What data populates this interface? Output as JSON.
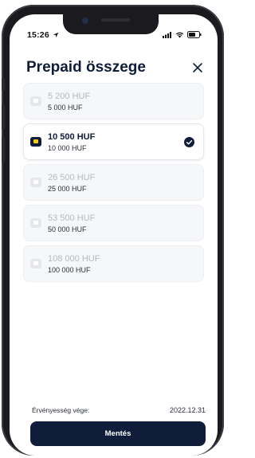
{
  "status_bar": {
    "time": "15:26",
    "location_icon": "location-arrow-icon",
    "signal_icon": "cellular-signal-icon",
    "wifi_icon": "wifi-icon",
    "battery_icon": "battery-icon"
  },
  "header": {
    "title": "Prepaid összege",
    "close_icon": "close-icon"
  },
  "options": [
    {
      "price": "5 200 HUF",
      "credit": "5 000 HUF",
      "selected": false
    },
    {
      "price": "10 500 HUF",
      "credit": "10 000 HUF",
      "selected": true
    },
    {
      "price": "26 500 HUF",
      "credit": "25 000 HUF",
      "selected": false
    },
    {
      "price": "53 500 HUF",
      "credit": "50 000 HUF",
      "selected": false
    },
    {
      "price": "108 000 HUF",
      "credit": "100 000 HUF",
      "selected": false
    }
  ],
  "footer": {
    "validity_label": "Érvényesség vége:",
    "validity_date": "2022.12.31",
    "save_label": "Mentés"
  },
  "colors": {
    "primary": "#0f1d3a",
    "card_icon_accent": "#f5c518",
    "disabled_text": "#b5b9c2",
    "background": "#ffffff"
  }
}
